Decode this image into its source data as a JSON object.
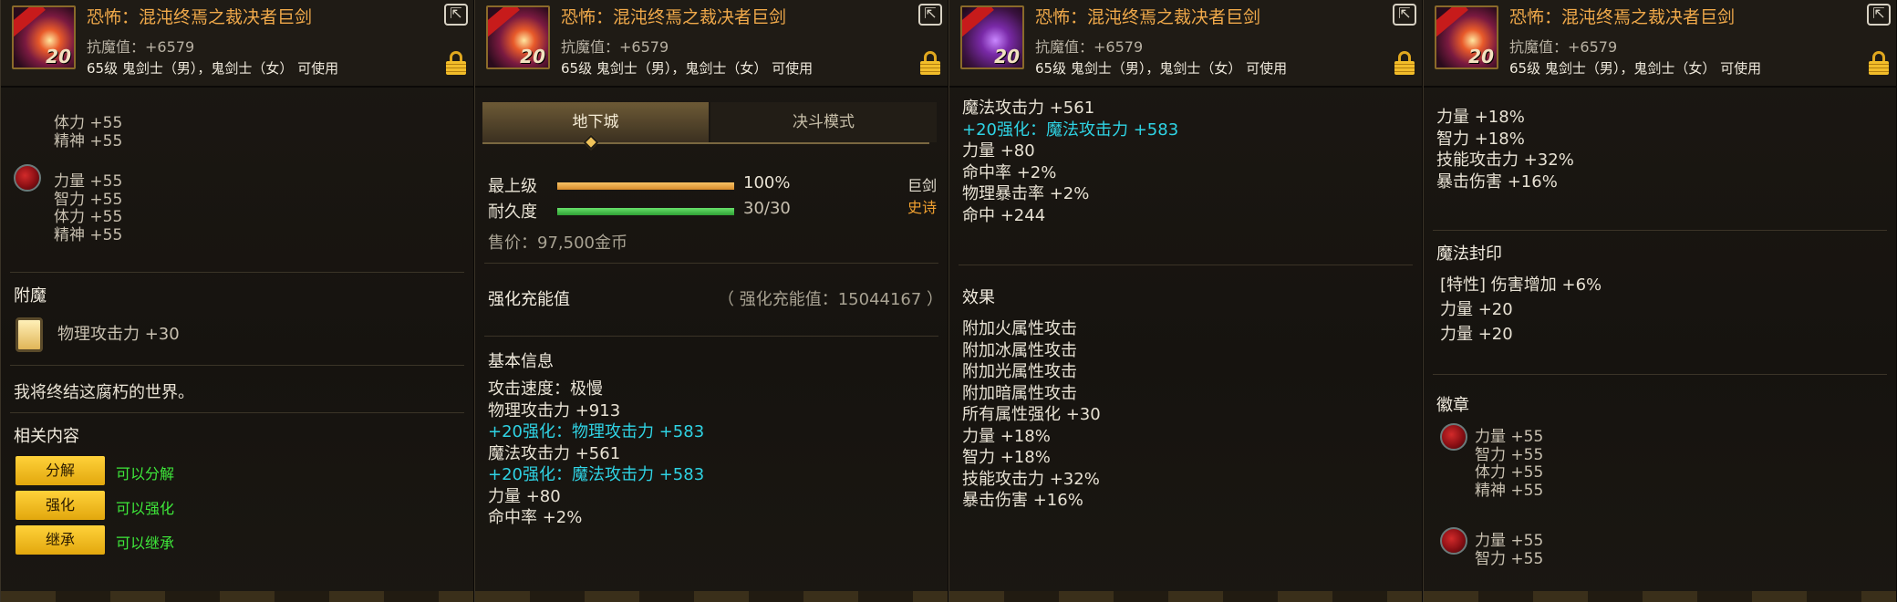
{
  "item": {
    "title": "恐怖：混沌终焉之裁决者巨剑",
    "resist": "抗魔值：+6579",
    "requirement": "65级 鬼剑士（男），鬼剑士（女） 可使用",
    "enhance_level": "20"
  },
  "panel1": {
    "tabs": [
      "地下城",
      "决斗模式"
    ],
    "grade_label": "最上级",
    "grade_value": "100%",
    "grade_fraction": 1.0,
    "durability_label": "耐久度",
    "durability_value": "30/30",
    "durability_fraction": 1.0,
    "weapon_type": "巨剑",
    "rarity": "史诗",
    "price": "售价：97,500金币",
    "charge_label": "强化充能值",
    "charge_value": "（ 强化充能值：15044167 ）",
    "basic_info": "基本信息",
    "lines": [
      {
        "text": "攻击速度：极慢",
        "cyan": false
      },
      {
        "text": "物理攻击力 +913",
        "cyan": false
      },
      {
        "text": "+20强化：物理攻击力 +583",
        "cyan": true
      },
      {
        "text": "魔法攻击力 +561",
        "cyan": false
      },
      {
        "text": "+20强化：魔法攻击力 +583",
        "cyan": true
      },
      {
        "text": "力量 +80",
        "cyan": false
      },
      {
        "text": "命中率 +2%",
        "cyan": false
      }
    ]
  },
  "panel2": {
    "lines": [
      {
        "text": "魔法攻击力 +561",
        "cyan": false
      },
      {
        "text": "+20强化：魔法攻击力 +583",
        "cyan": true
      },
      {
        "text": "力量 +80",
        "cyan": false
      },
      {
        "text": "命中率 +2%",
        "cyan": false
      },
      {
        "text": "物理暴击率 +2%",
        "cyan": false
      },
      {
        "text": "命中 +244",
        "cyan": false
      }
    ],
    "effects_title": "效果",
    "effects": [
      "附加火属性攻击",
      "附加冰属性攻击",
      "附加光属性攻击",
      "附加暗属性攻击",
      "所有属性强化 +30",
      "力量 +18%",
      "智力 +18%",
      "技能攻击力 +32%",
      "暴击伤害 +16%"
    ]
  },
  "panel3": {
    "lines": [
      "力量 +18%",
      "智力 +18%",
      "技能攻击力 +32%",
      "暴击伤害 +16%"
    ],
    "seal_title": "魔法封印",
    "seal_lines": [
      "[特性] 伤害增加 +6%",
      "力量 +20",
      "力量 +20"
    ],
    "emblem_title": "徽章",
    "emblem1": [
      "力量 +55",
      "智力 +55",
      "体力 +55",
      "精神 +55"
    ],
    "emblem2": [
      "力量 +55",
      "智力 +55"
    ]
  },
  "panel4": {
    "top_lines": [
      "体力 +55",
      "精神 +55"
    ],
    "emblem": [
      "力量 +55",
      "智力 +55",
      "体力 +55",
      "精神 +55"
    ],
    "enchant_title": "附魔",
    "enchant_text": "物理攻击力 +30",
    "flavor": "我将终结这腐朽的世界。",
    "related_title": "相关内容",
    "actions": [
      {
        "button": "分解",
        "status": "可以分解"
      },
      {
        "button": "强化",
        "status": "可以强化"
      },
      {
        "button": "继承",
        "status": "可以继承"
      }
    ]
  }
}
